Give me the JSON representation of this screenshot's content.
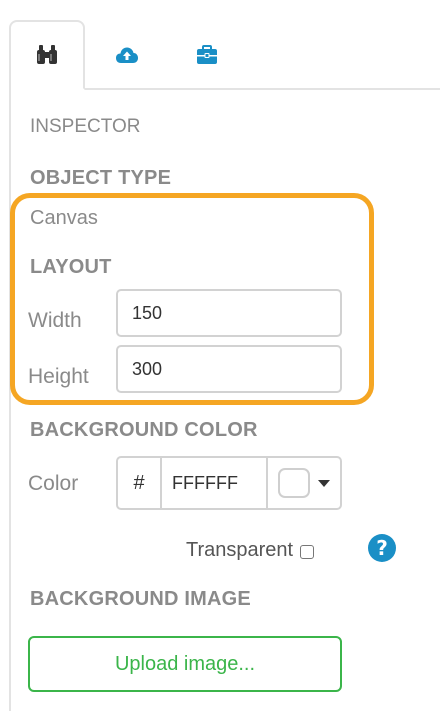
{
  "tabs": [
    {
      "icon": "binoculars-icon",
      "active": true
    },
    {
      "icon": "cloud-upload-icon",
      "active": false
    },
    {
      "icon": "briefcase-icon",
      "active": false
    }
  ],
  "inspector": {
    "title": "INSPECTOR",
    "object_type_heading": "OBJECT TYPE",
    "object_type_value": "Canvas",
    "layout_heading": "LAYOUT",
    "width_label": "Width",
    "width_value": "150",
    "height_label": "Height",
    "height_value": "300",
    "bg_color_heading": "BACKGROUND COLOR",
    "color_label": "Color",
    "hash_symbol": "#",
    "color_hex": "FFFFFF",
    "transparent_label": "Transparent",
    "help_symbol": "?",
    "bg_image_heading": "BACKGROUND IMAGE",
    "upload_label": "Upload image..."
  },
  "colors": {
    "highlight": "#f5a623",
    "accent_green": "#3bb54a",
    "help_blue": "#1a8fc6",
    "tab_icon_dark": "#333333",
    "tab_icon_teal": "#1a8fc6"
  }
}
